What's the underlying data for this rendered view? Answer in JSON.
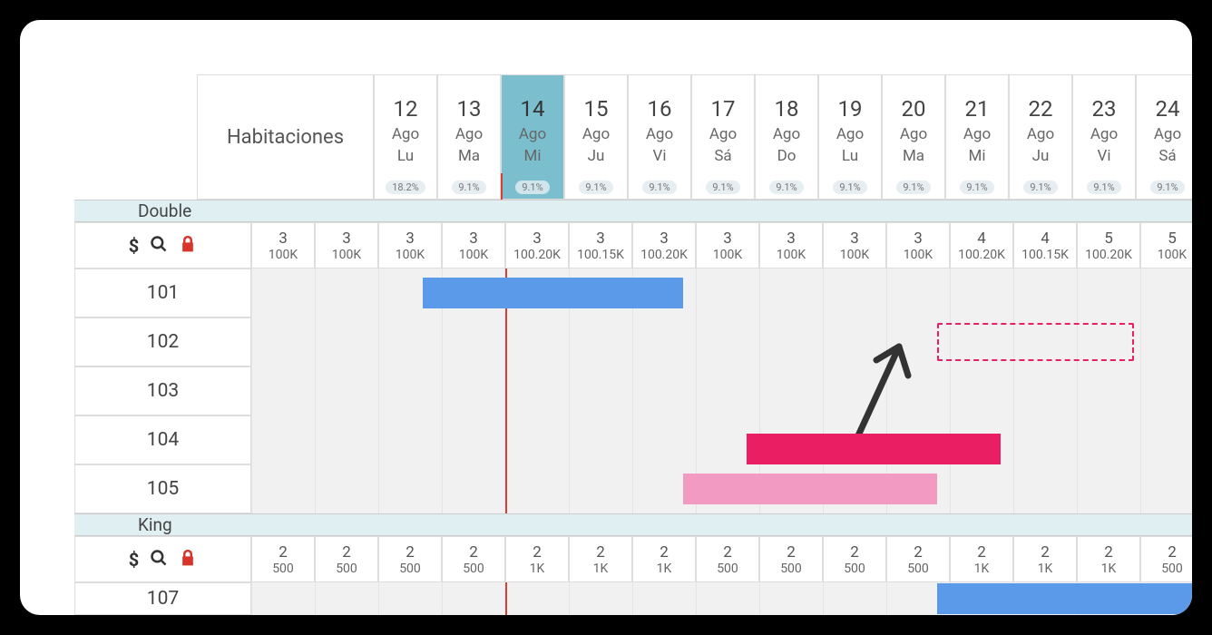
{
  "header_rooms_label": "Habitaciones",
  "dates": [
    {
      "day": "12",
      "mon": "Ago",
      "dow": "Lu",
      "pct": "18.2%",
      "today": false
    },
    {
      "day": "13",
      "mon": "Ago",
      "dow": "Ma",
      "pct": "9.1%",
      "today": false
    },
    {
      "day": "14",
      "mon": "Ago",
      "dow": "Mi",
      "pct": "9.1%",
      "today": true
    },
    {
      "day": "15",
      "mon": "Ago",
      "dow": "Ju",
      "pct": "9.1%",
      "today": false
    },
    {
      "day": "16",
      "mon": "Ago",
      "dow": "Vi",
      "pct": "9.1%",
      "today": false
    },
    {
      "day": "17",
      "mon": "Ago",
      "dow": "Sá",
      "pct": "9.1%",
      "today": false
    },
    {
      "day": "18",
      "mon": "Ago",
      "dow": "Do",
      "pct": "9.1%",
      "today": false
    },
    {
      "day": "19",
      "mon": "Ago",
      "dow": "Lu",
      "pct": "9.1%",
      "today": false
    },
    {
      "day": "20",
      "mon": "Ago",
      "dow": "Ma",
      "pct": "9.1%",
      "today": false
    },
    {
      "day": "21",
      "mon": "Ago",
      "dow": "Mi",
      "pct": "9.1%",
      "today": false
    },
    {
      "day": "22",
      "mon": "Ago",
      "dow": "Ju",
      "pct": "9.1%",
      "today": false
    },
    {
      "day": "23",
      "mon": "Ago",
      "dow": "Vi",
      "pct": "9.1%",
      "today": false
    },
    {
      "day": "24",
      "mon": "Ago",
      "dow": "Sá",
      "pct": "9.1%",
      "today": false
    }
  ],
  "categories": [
    {
      "name": "Double",
      "rooms": [
        "101",
        "102",
        "103",
        "104",
        "105"
      ],
      "rates": [
        {
          "avail": "3",
          "price": "100K"
        },
        {
          "avail": "3",
          "price": "100K"
        },
        {
          "avail": "3",
          "price": "100K"
        },
        {
          "avail": "3",
          "price": "100K"
        },
        {
          "avail": "3",
          "price": "100.20K"
        },
        {
          "avail": "3",
          "price": "100.15K"
        },
        {
          "avail": "3",
          "price": "100.20K"
        },
        {
          "avail": "3",
          "price": "100K"
        },
        {
          "avail": "3",
          "price": "100K"
        },
        {
          "avail": "3",
          "price": "100K"
        },
        {
          "avail": "3",
          "price": "100K"
        },
        {
          "avail": "4",
          "price": "100.20K"
        },
        {
          "avail": "4",
          "price": "100.15K"
        },
        {
          "avail": "5",
          "price": "100.20K"
        },
        {
          "avail": "5",
          "price": "100K"
        }
      ]
    },
    {
      "name": "King",
      "rooms": [
        "107"
      ],
      "rates": [
        {
          "avail": "2",
          "price": "500"
        },
        {
          "avail": "2",
          "price": "500"
        },
        {
          "avail": "2",
          "price": "500"
        },
        {
          "avail": "2",
          "price": "500"
        },
        {
          "avail": "2",
          "price": "1K"
        },
        {
          "avail": "2",
          "price": "1K"
        },
        {
          "avail": "2",
          "price": "1K"
        },
        {
          "avail": "2",
          "price": "500"
        },
        {
          "avail": "2",
          "price": "500"
        },
        {
          "avail": "2",
          "price": "500"
        },
        {
          "avail": "2",
          "price": "500"
        },
        {
          "avail": "2",
          "price": "1K"
        },
        {
          "avail": "2",
          "price": "1K"
        },
        {
          "avail": "2",
          "price": "1K"
        },
        {
          "avail": "2",
          "price": "500"
        }
      ]
    }
  ],
  "chart_data": {
    "type": "gantt",
    "bookings": [
      {
        "room": "101",
        "start_col": 0.7,
        "end_col": 4.8,
        "color": "blue"
      },
      {
        "room": "105",
        "start_col": 4.8,
        "end_col": 8.8,
        "color": "pink"
      },
      {
        "room": "104",
        "start_col": 5.8,
        "end_col": 9.8,
        "color": "magenta",
        "offset_down": true
      },
      {
        "room": "107",
        "start_col": 8.8,
        "end_col": 12.9,
        "color": "blue"
      }
    ],
    "placeholder": {
      "room": "102",
      "start_col": 8.8,
      "end_col": 11.9
    },
    "today_line_col": 2.0
  }
}
